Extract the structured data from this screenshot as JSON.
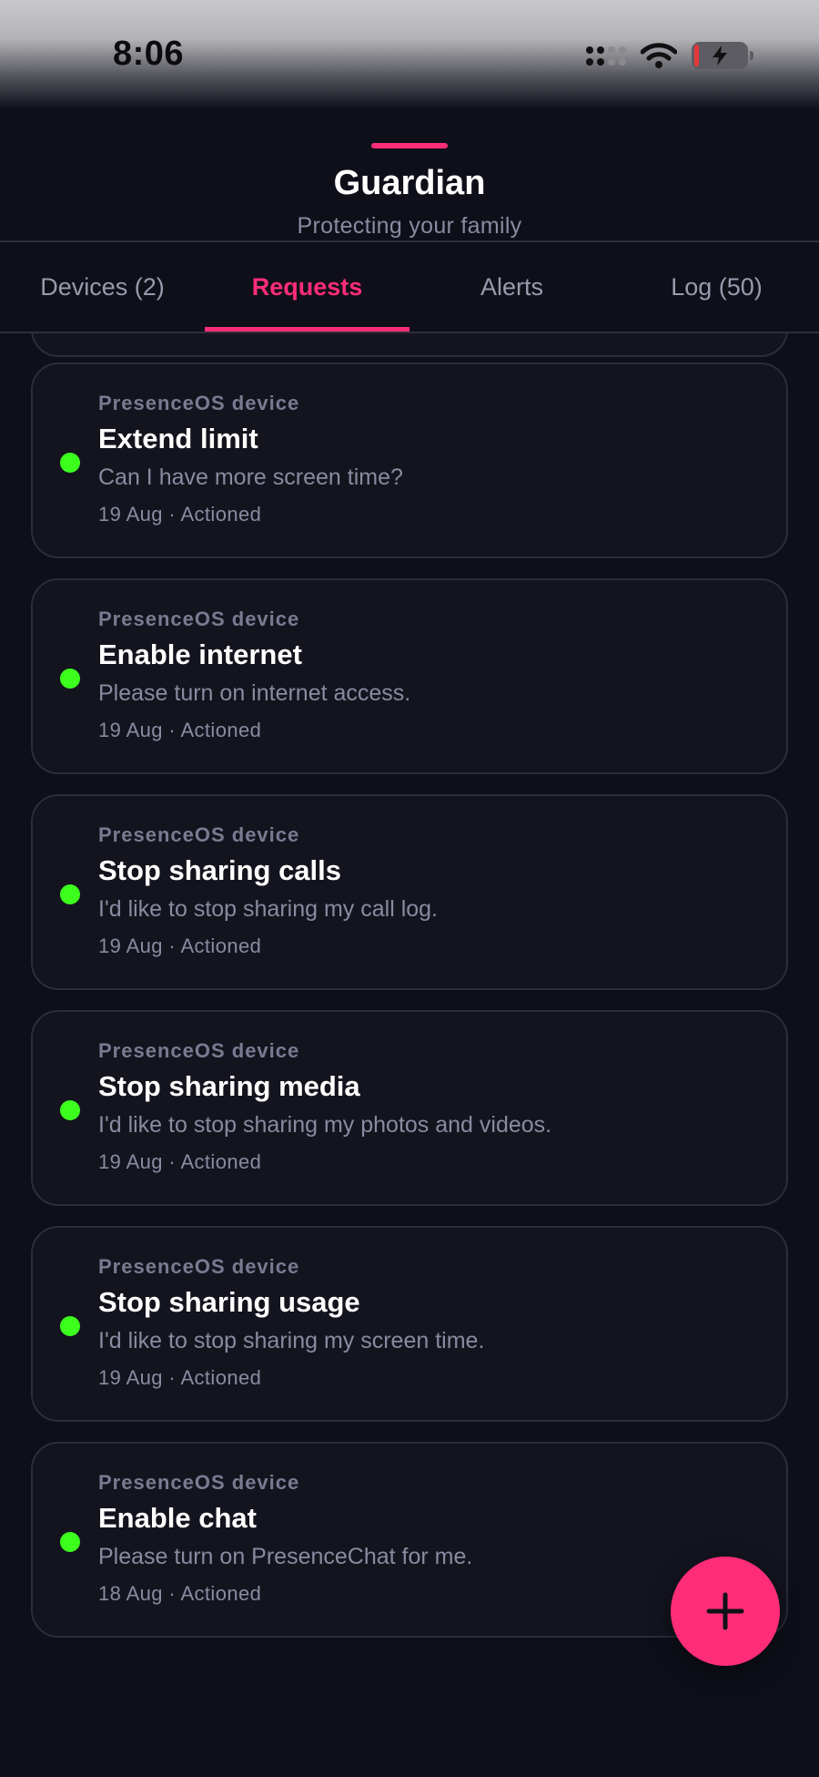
{
  "status_bar": {
    "time": "8:06",
    "icons": [
      "signal-icon",
      "wifi-icon",
      "battery-charging-icon"
    ]
  },
  "header": {
    "title": "Guardian",
    "subtitle": "Protecting your family",
    "accent_color": "#ff2d78"
  },
  "tabs": [
    {
      "label": "Devices (2)",
      "active": false
    },
    {
      "label": "Requests",
      "active": true
    },
    {
      "label": "Alerts",
      "active": false
    },
    {
      "label": "Log (50)",
      "active": false
    }
  ],
  "requests": [
    {
      "device": "PresenceOS device",
      "title": "Extend limit",
      "message": "Can I have more screen time?",
      "meta": "19 Aug · Actioned",
      "status_color": "#3cff1e"
    },
    {
      "device": "PresenceOS device",
      "title": "Enable internet",
      "message": "Please turn on internet access.",
      "meta": "19 Aug · Actioned",
      "status_color": "#3cff1e"
    },
    {
      "device": "PresenceOS device",
      "title": "Stop sharing calls",
      "message": "I'd like to stop sharing my call log.",
      "meta": "19 Aug · Actioned",
      "status_color": "#3cff1e"
    },
    {
      "device": "PresenceOS device",
      "title": "Stop sharing media",
      "message": "I'd like to stop sharing my photos and videos.",
      "meta": "19 Aug · Actioned",
      "status_color": "#3cff1e"
    },
    {
      "device": "PresenceOS device",
      "title": "Stop sharing usage",
      "message": "I'd like to stop sharing my screen time.",
      "meta": "19 Aug · Actioned",
      "status_color": "#3cff1e"
    },
    {
      "device": "PresenceOS device",
      "title": "Enable chat",
      "message": "Please turn on PresenceChat for me.",
      "meta": "18 Aug · Actioned",
      "status_color": "#3cff1e"
    }
  ],
  "fab": {
    "icon": "plus-icon"
  }
}
